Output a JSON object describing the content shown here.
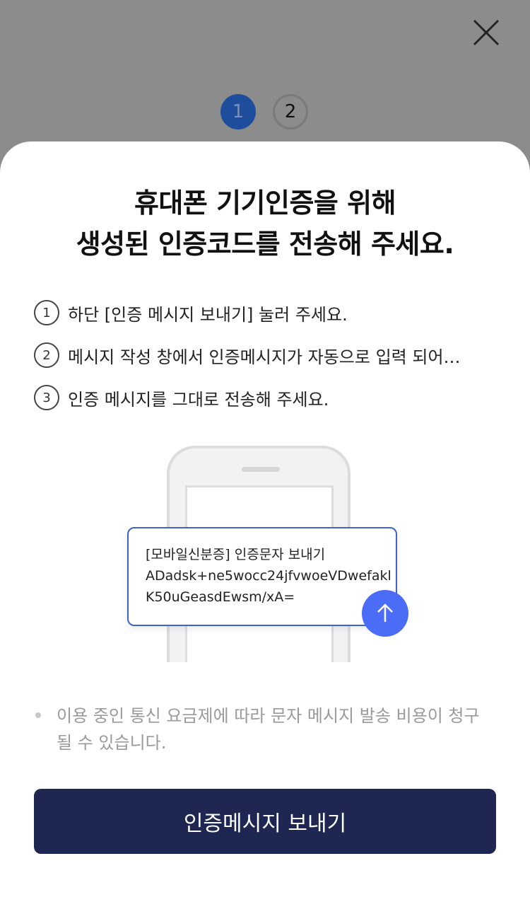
{
  "header": {
    "close_icon": "close-icon",
    "steps": [
      "1",
      "2"
    ],
    "active_step": "1"
  },
  "title": {
    "line1": "휴대폰 기기인증을 위해",
    "line2": "생성된 인증코드를 전송해 주세요."
  },
  "instructions": [
    {
      "num": "1",
      "text": "하단 [인증 메시지 보내기] 눌러 주세요."
    },
    {
      "num": "2",
      "text": "메시지 작성 창에서 인증메시지가 자동으로 입력 되어…"
    },
    {
      "num": "3",
      "text": "인증 메시지를 그대로 전송해 주세요."
    }
  ],
  "message_preview": {
    "line1": "[모바일신분증] 인증문자 보내기",
    "line2": "ADadsk+ne5wocc24jfvwoeVDwefakl",
    "line3": "K50uGeasdEwsm/xA=",
    "send_icon": "arrow-up-icon"
  },
  "notice": {
    "text": "이용 중인 통신 요금제에 따라 문자 메시지 발송 비용이 청구 될 수 있습니다."
  },
  "primary_button": {
    "label": "인증메시지 보내기"
  },
  "colors": {
    "primary_button_bg": "#1e2752",
    "active_step_bg": "#1f4d9e",
    "send_button_bg": "#4a6cf7",
    "message_border": "#3f63c9"
  }
}
